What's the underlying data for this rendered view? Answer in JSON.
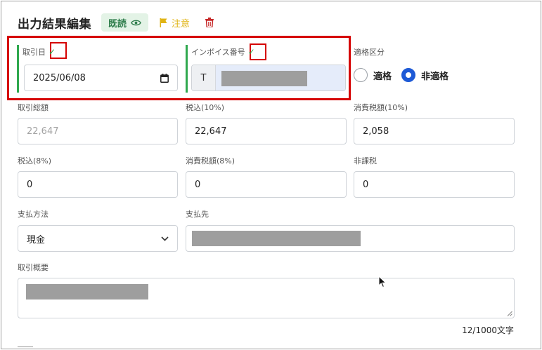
{
  "header": {
    "title": "出力結果編集",
    "read_badge": "既読",
    "caution": "注意"
  },
  "fields": {
    "transaction_date": {
      "label": "取引日",
      "value": "2025/06/08"
    },
    "invoice_number": {
      "label": "インボイス番号",
      "prefix": "T"
    },
    "qualification": {
      "label": "適格区分",
      "options": [
        "適格",
        "非適格"
      ],
      "selected": "非適格"
    },
    "total_amount": {
      "label": "取引総額",
      "value": "22,647"
    },
    "tax_incl_10": {
      "label": "税込(10%)",
      "value": "22,647"
    },
    "consumption_tax_10": {
      "label": "消費税額(10%)",
      "value": "2,058"
    },
    "tax_incl_8": {
      "label": "税込(8%)",
      "value": "0"
    },
    "consumption_tax_8": {
      "label": "消費税額(8%)",
      "value": "0"
    },
    "non_taxable": {
      "label": "非課税",
      "value": "0"
    },
    "payment_method": {
      "label": "支払方法",
      "value": "現金"
    },
    "payee": {
      "label": "支払先"
    },
    "summary": {
      "label": "取引概要",
      "counter": "12/1000文字"
    }
  },
  "icons": [
    "eye-icon",
    "flag-icon",
    "trash-icon",
    "check-icon",
    "calendar-icon",
    "chevron-down-icon",
    "resize-handle-icon",
    "mouse-cursor-icon"
  ],
  "colors": {
    "accent_green": "#2fa84f",
    "selected_radio": "#1e5ad6",
    "highlight_red": "#d50000",
    "caution_yellow": "#e0b416",
    "trash_red": "#c62828"
  }
}
